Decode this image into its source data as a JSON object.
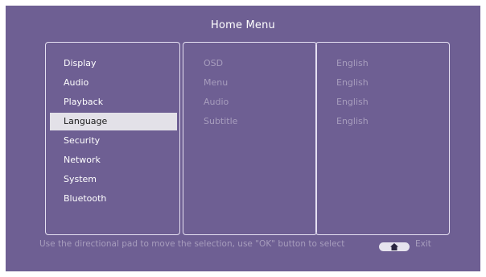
{
  "title": "Home Menu",
  "menu": [
    {
      "label": "Display"
    },
    {
      "label": "Audio"
    },
    {
      "label": "Playback"
    },
    {
      "label": "Language",
      "selected": true
    },
    {
      "label": "Security"
    },
    {
      "label": "Network"
    },
    {
      "label": "System"
    },
    {
      "label": "Bluetooth"
    }
  ],
  "language_options": [
    {
      "label": "OSD",
      "value": "English"
    },
    {
      "label": "Menu",
      "value": "English"
    },
    {
      "label": "Audio",
      "value": "English"
    },
    {
      "label": "Subtitle",
      "value": "English"
    }
  ],
  "footer": {
    "hint": "Use the directional pad to move the selection, use \"OK\" button to select",
    "exit_label": "Exit",
    "home_icon": "home-icon"
  },
  "colors": {
    "background": "#6e5f93",
    "highlight": "#e3e1e8",
    "dimmed_text": "#a79dbd",
    "text": "#ffffff"
  }
}
